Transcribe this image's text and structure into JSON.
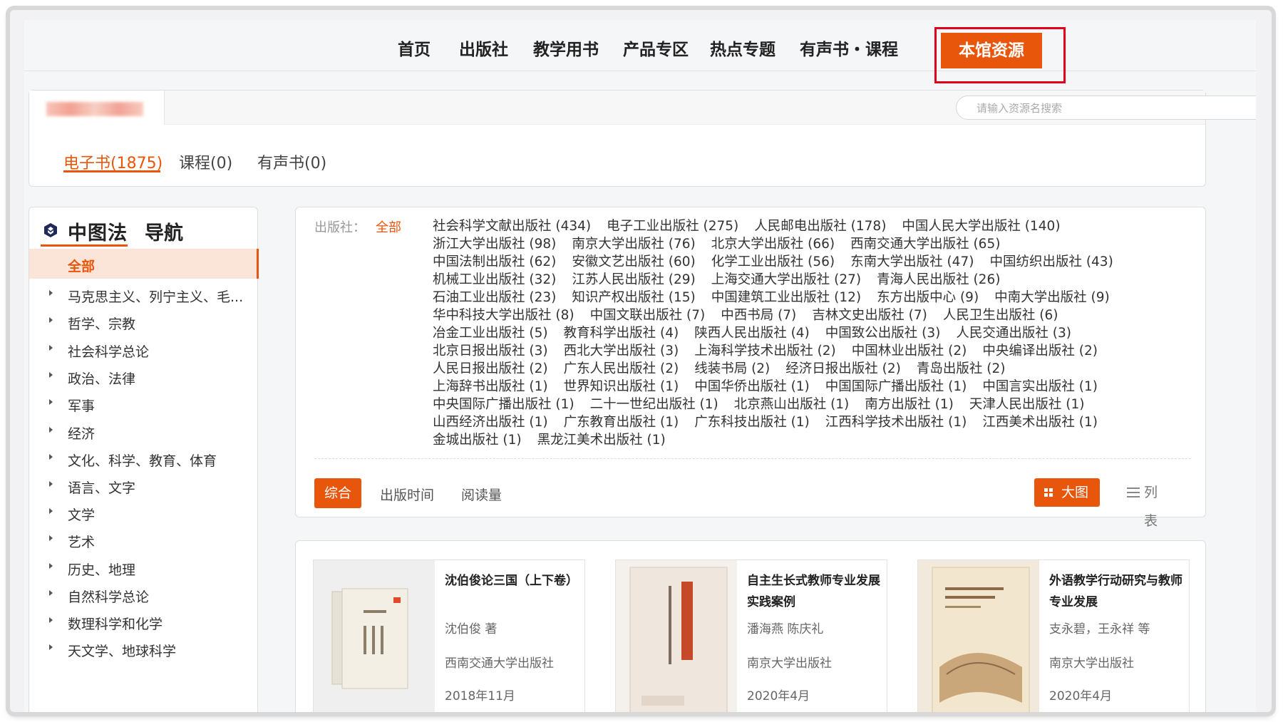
{
  "nav": {
    "items": [
      "首页",
      "出版社",
      "教学用书",
      "产品专区",
      "热点专题",
      "有声书・课程"
    ],
    "active": "本馆资源"
  },
  "search": {
    "placeholder": "请输入资源名搜索"
  },
  "resource_tabs": [
    {
      "label": "电子书(1875)",
      "active": true
    },
    {
      "label": "课程(0)",
      "active": false
    },
    {
      "label": "有声书(0)",
      "active": false
    }
  ],
  "sidebar": {
    "title": "中图法",
    "title2": "导航",
    "all_label": "全部",
    "items": [
      "马克思主义、列宁主义、毛...",
      "哲学、宗教",
      "社会科学总论",
      "政治、法律",
      "军事",
      "经济",
      "文化、科学、教育、体育",
      "语言、文字",
      "文学",
      "艺术",
      "历史、地理",
      "自然科学总论",
      "数理科学和化学",
      "天文学、地球科学"
    ]
  },
  "publishers": {
    "label": "出版社：",
    "all": "全部",
    "rows": [
      [
        "社会科学文献出版社 (434)",
        "电子工业出版社 (275)",
        "人民邮电出版社 (178)",
        "中国人民大学出版社 (140)"
      ],
      [
        "浙江大学出版社 (98)",
        "南京大学出版社 (76)",
        "北京大学出版社 (66)",
        "西南交通大学出版社 (65)"
      ],
      [
        "中国法制出版社 (62)",
        "安徽文艺出版社 (60)",
        "化学工业出版社 (56)",
        "东南大学出版社 (47)",
        "中国纺织出版社 (43)"
      ],
      [
        "机械工业出版社 (32)",
        "江苏人民出版社 (29)",
        "上海交通大学出版社 (27)",
        "青海人民出版社 (26)"
      ],
      [
        "石油工业出版社 (23)",
        "知识产权出版社 (15)",
        "中国建筑工业出版社 (12)",
        "东方出版中心 (9)",
        "中南大学出版社 (9)"
      ],
      [
        "华中科技大学出版社 (8)",
        "中国文联出版社 (7)",
        "中西书局 (7)",
        "吉林文史出版社 (7)",
        "人民卫生出版社 (6)"
      ],
      [
        "冶金工业出版社 (5)",
        "教育科学出版社 (4)",
        "陕西人民出版社 (4)",
        "中国致公出版社 (3)",
        "人民交通出版社 (3)"
      ],
      [
        "北京日报出版社 (3)",
        "西北大学出版社 (3)",
        "上海科学技术出版社 (2)",
        "中国林业出版社 (2)",
        "中央编译出版社 (2)"
      ],
      [
        "人民日报出版社 (2)",
        "广东人民出版社 (2)",
        "线装书局 (2)",
        "经济日报出版社 (2)",
        "青岛出版社 (2)"
      ],
      [
        "上海辞书出版社 (1)",
        "世界知识出版社 (1)",
        "中国华侨出版社 (1)",
        "中国国际广播出版社 (1)",
        "中国言实出版社 (1)"
      ],
      [
        "中央国际广播出版社 (1)",
        "二十一世纪出版社 (1)",
        "北京燕山出版社 (1)",
        "南方出版社 (1)",
        "天津人民出版社 (1)"
      ],
      [
        "山西经济出版社 (1)",
        "广东教育出版社 (1)",
        "广东科技出版社 (1)",
        "江西科学技术出版社 (1)",
        "江西美术出版社 (1)"
      ],
      [
        "金城出版社 (1)",
        "黑龙江美术出版社 (1)"
      ]
    ]
  },
  "sort": {
    "active": "综合",
    "time": "出版时间",
    "reads": "阅读量"
  },
  "view": {
    "big": "大图",
    "list": "列表"
  },
  "books": [
    {
      "title": "沈伯俊论三国（上下卷）",
      "author": "沈伯俊 著",
      "publisher": "西南交通大学出版社",
      "date": "2018年11月"
    },
    {
      "title": "自主生长式教师专业发展实践案例",
      "author": "潘海燕 陈庆礼",
      "publisher": "南京大学出版社",
      "date": "2020年4月"
    },
    {
      "title": "外语教学行动研究与教师专业发展",
      "author": "支永碧，王永祥 等",
      "publisher": "南京大学出版社",
      "date": "2020年4月"
    }
  ],
  "colors": {
    "accent": "#e8560b",
    "highlight": "#e2001a"
  }
}
